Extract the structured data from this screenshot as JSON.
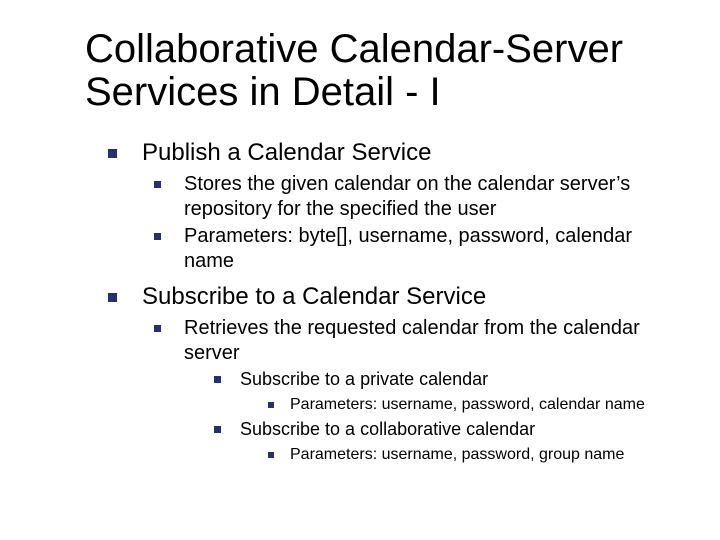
{
  "title": "Collaborative Calendar-Server Services in Detail - I",
  "s1": {
    "h": "Publish a Calendar Service",
    "p1": "Stores the given calendar on the calendar server’s repository for the specified the user",
    "p2": "Parameters: byte[], username, password, calendar name"
  },
  "s2": {
    "h": "Subscribe to a Calendar Service",
    "p1": "Retrieves the requested calendar from the calendar server",
    "a": {
      "h": "Subscribe to a private calendar",
      "p": "Parameters: username, password, calendar name"
    },
    "b": {
      "h": "Subscribe to a collaborative calendar",
      "p": "Parameters: username, password, group name"
    }
  }
}
